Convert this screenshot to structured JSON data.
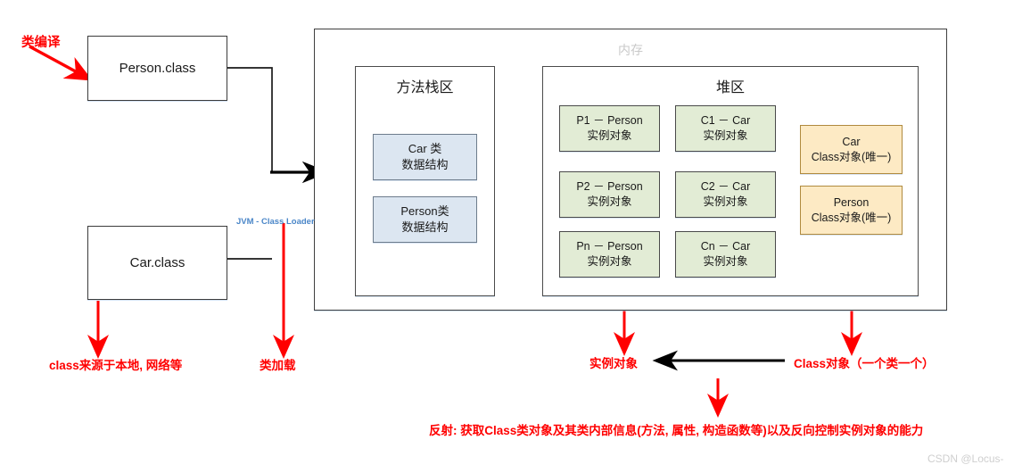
{
  "diagram": {
    "title_watermark": "CSDN @Locus-",
    "class_files": [
      {
        "label": "Person.class"
      },
      {
        "label": "Car.class"
      }
    ],
    "memory": {
      "label": "内存",
      "method_area": {
        "label": "方法栈区",
        "cells": [
          {
            "line1": "Car 类",
            "line2": "数据结构"
          },
          {
            "line1": "Person类",
            "line2": "数据结构"
          }
        ]
      },
      "heap": {
        "label": "堆区",
        "instances_person": [
          {
            "line1": "P1 － Person",
            "line2": "实例对象"
          },
          {
            "line1": "P2 － Person",
            "line2": "实例对象"
          },
          {
            "line1": "Pn － Person",
            "line2": "实例对象"
          }
        ],
        "instances_car": [
          {
            "line1": "C1 － Car",
            "line2": "实例对象"
          },
          {
            "line1": "C2 － Car",
            "line2": "实例对象"
          },
          {
            "line1": "Cn － Car",
            "line2": "实例对象"
          }
        ],
        "class_objects": [
          {
            "line1": "Car",
            "line2": "Class对象(唯一)"
          },
          {
            "line1": "Person",
            "line2": "Class对象(唯一)"
          }
        ]
      }
    },
    "annotations": {
      "compile": "类编译",
      "class_loader": "JVM - Class Loader",
      "class_source": "class来源于本地, 网络等",
      "class_load": "类加载",
      "instance_object": "实例对象",
      "class_object": "Class对象（一个类一个）",
      "reflection": "反射: 获取Class类对象及其类内部信息(方法, 属性, 构造函数等)以及反向控制实例对象的能力"
    },
    "colors": {
      "red": "#ff0000",
      "blue_label": "#4a86c8",
      "cell_blue": "#dce6f1",
      "cell_green": "#e2ecd5",
      "cell_orange": "#fdeac4",
      "outline": "#3b3b3b",
      "memory_label": "#c9c9c9",
      "watermark": "#cfcfcf"
    }
  }
}
